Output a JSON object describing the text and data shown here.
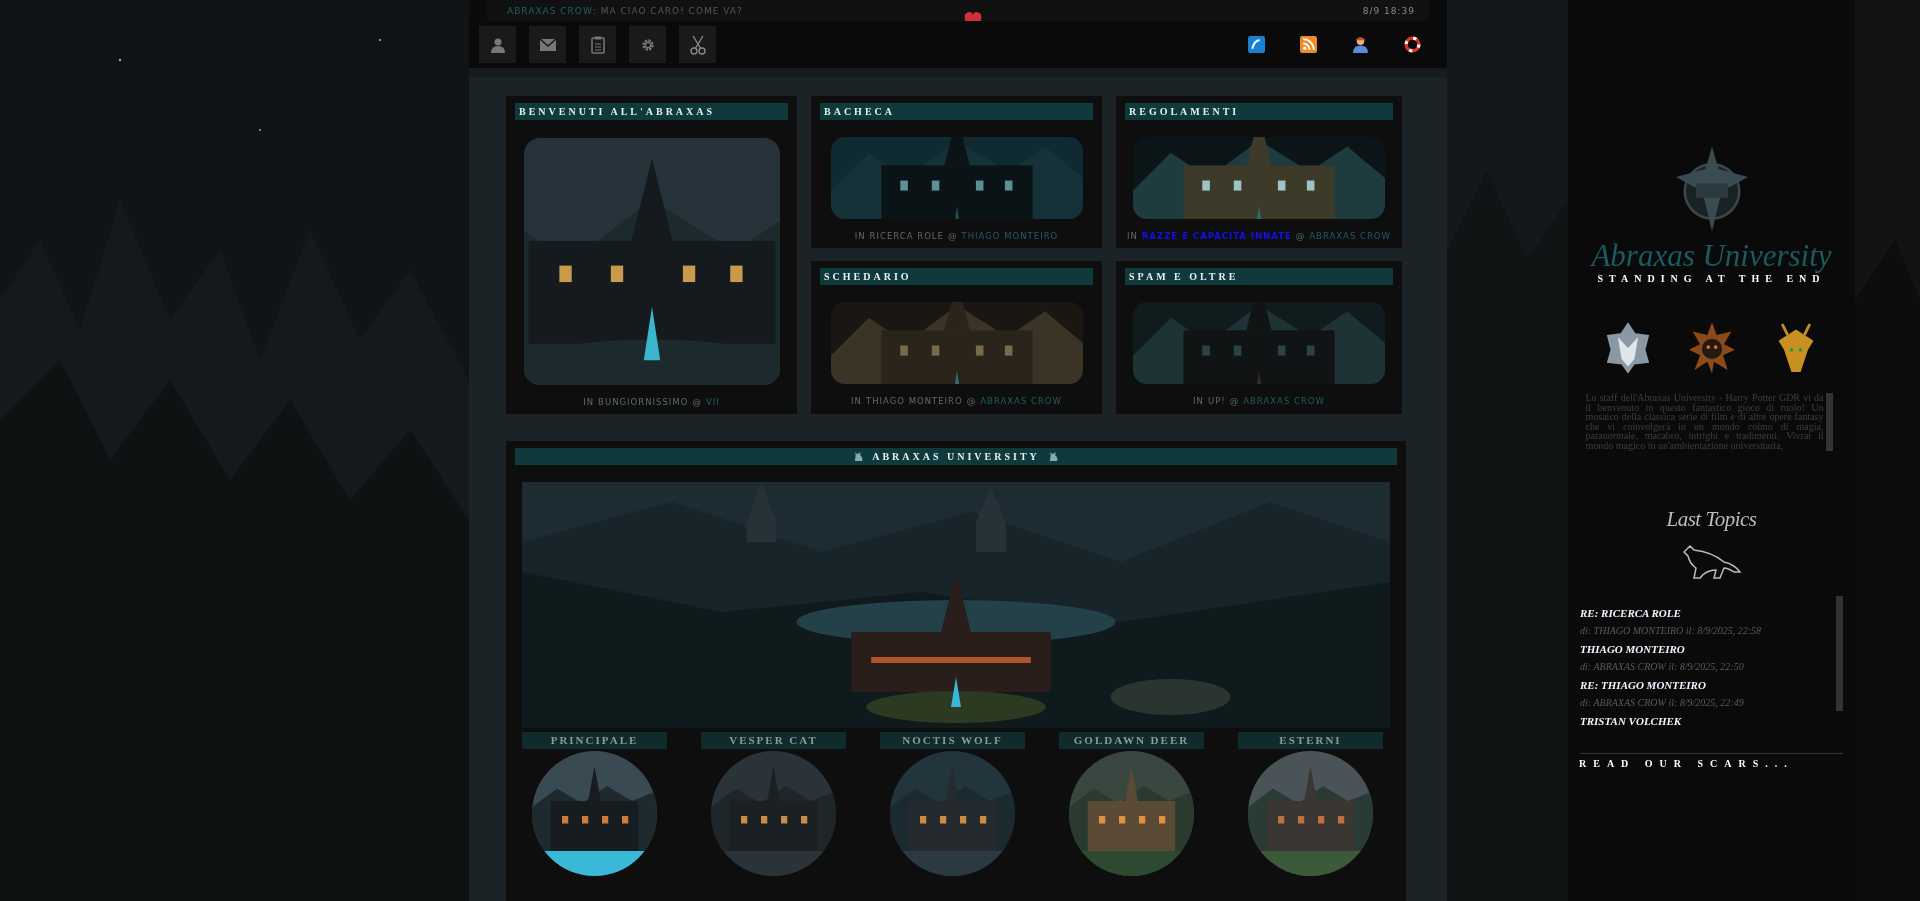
{
  "chat": {
    "user": "ABRAXAS CROW",
    "message": ": MA CIAO CARO! COME VA?",
    "time": "8/9 18:39"
  },
  "boxes": [
    {
      "title": "BENVENUTI ALL'ABRAXAS",
      "caption": {
        "lead": "IN",
        "forum": "BUNGIORNISSIMO",
        "forum_highlight": false,
        "at": "@",
        "user": "VII"
      }
    },
    {
      "title": "BACHECA",
      "caption": {
        "lead": "IN",
        "forum": "RICERCA ROLE",
        "forum_highlight": false,
        "at": "@",
        "user": "THIAGO MONTEIRO"
      }
    },
    {
      "title": "REGOLAMENTI",
      "caption": {
        "lead": "IN",
        "forum": "RAZZE E CAPACITÀ INNATE",
        "forum_highlight": true,
        "at": "@",
        "user": "ABRAXAS CROW"
      }
    },
    {
      "title": "SCHEDARIO",
      "caption": {
        "lead": "IN",
        "forum": "THIAGO MONTEIRO",
        "forum_highlight": false,
        "at": "@",
        "user": "ABRAXAS CROW"
      }
    },
    {
      "title": "SPAM E OLTRE",
      "caption": {
        "lead": "IN",
        "forum": "UP!",
        "forum_highlight": false,
        "at": "@",
        "user": "ABRAXAS CROW"
      }
    }
  ],
  "university": {
    "title": "ABRAXAS UNIVERSITY",
    "houses": [
      "PRINCIPALE",
      "VESPER CAT",
      "NOCTIS WOLF",
      "GOLDAWN DEER",
      "ESTERNI"
    ]
  },
  "sidebar": {
    "title": "Abraxas University",
    "subtitle": "STANDING AT THE END",
    "description": "Lo staff dell'Abraxas University - Harry Potter GDR vi da il benvenuto in questo fantastico gioco di ruolo! Un mosaico della classica serie di film e di altre opere fantasy che vi coinvolgerà in un mondo colmo di magia, paranormale, macabro, intrighi e tradimenti. Vivrai il mondo magico in un'ambientazione universitaria,",
    "topics_title": "Last Topics",
    "topics": [
      {
        "title": "RE: RICERCA ROLE",
        "meta": "di: THIAGO MONTEIRO il: 8/9/2025, 22:58"
      },
      {
        "title": "THIAGO MONTEIRO",
        "meta": "di: ABRAXAS CROW il: 8/9/2025, 22:50"
      },
      {
        "title": "RE: THIAGO MONTEIRO",
        "meta": "di: ABRAXAS CROW il: 8/9/2025, 22:49"
      },
      {
        "title": "TRISTAN VOLCHEK"
      }
    ],
    "footer": "READ OUR SCARS..."
  }
}
